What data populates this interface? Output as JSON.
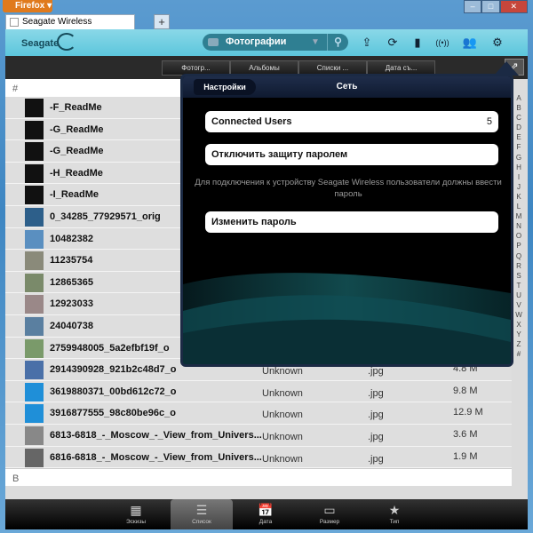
{
  "browser": {
    "menu": "Firefox",
    "tab_title": "Seagate Wireless",
    "new_tab": "+",
    "controls": [
      "–",
      "□",
      "✕"
    ]
  },
  "header": {
    "logo": "Seagate",
    "search_category": "Фотографии",
    "icons": [
      "upload-icon",
      "sync-icon",
      "battery-icon",
      "wifi-icon",
      "users-icon",
      "gear-icon"
    ]
  },
  "sort_tabs": [
    "Фотогр...",
    "Альбомы",
    "Списки ...",
    "Дата съ..."
  ],
  "list": {
    "section_hash": "#",
    "section_b": "B",
    "rows": [
      {
        "name": "-F_ReadMe",
        "thumb": "#111111"
      },
      {
        "name": "-G_ReadMe",
        "thumb": "#111111"
      },
      {
        "name": "-G_ReadMe",
        "thumb": "#111111"
      },
      {
        "name": "-H_ReadMe",
        "thumb": "#111111"
      },
      {
        "name": "-I_ReadMe",
        "thumb": "#111111"
      },
      {
        "name": "0_34285_77929571_orig",
        "thumb": "#2d5f8a"
      },
      {
        "name": "10482382",
        "thumb": "#5a8fc0"
      },
      {
        "name": "11235754",
        "thumb": "#8a8a7a"
      },
      {
        "name": "12865365",
        "thumb": "#7a8a6a"
      },
      {
        "name": "12923033",
        "thumb": "#9a8888"
      },
      {
        "name": "24040738",
        "thumb": "#5a7fa0"
      },
      {
        "name": "2759948005_5a2efbf19f_o",
        "thumb": "#7a9a6a"
      },
      {
        "name": "2914390928_921b2c48d7_o",
        "thumb": "#4a70a8",
        "author": "Unknown",
        "type": ".jpg",
        "size": "4.8 M"
      },
      {
        "name": "3619880371_00bd612c72_o",
        "thumb": "#1f8fd8",
        "author": "Unknown",
        "type": ".jpg",
        "size": "9.8 M"
      },
      {
        "name": "3916877555_98c80be96c_o",
        "thumb": "#1f8fd8",
        "author": "Unknown",
        "type": ".jpg",
        "size": "12.9 M"
      },
      {
        "name": "6813-6818_-_Moscow_-_View_from_Univers...",
        "thumb": "#888888",
        "author": "Unknown",
        "type": ".jpg",
        "size": "3.6 M"
      },
      {
        "name": "6816-6818_-_Moscow_-_View_from_Univers...",
        "thumb": "#666666",
        "author": "Unknown",
        "type": ".jpg",
        "size": "1.9 M"
      }
    ]
  },
  "alphabet": [
    "A",
    "B",
    "C",
    "D",
    "E",
    "F",
    "G",
    "H",
    "I",
    "J",
    "K",
    "L",
    "M",
    "N",
    "O",
    "P",
    "Q",
    "R",
    "S",
    "T",
    "U",
    "V",
    "W",
    "X",
    "Y",
    "Z",
    "#"
  ],
  "popup": {
    "back": "Настройки",
    "title": "Сеть",
    "connected_users_label": "Connected Users",
    "connected_users_value": "5",
    "disable_password": "Отключить защиту паролем",
    "note": "Для подключения к устройству Seagate Wireless пользователи должны ввести пароль",
    "change_password": "Изменить пароль"
  },
  "bottom_tabs": [
    {
      "label": "Эскизы",
      "icon": "▦"
    },
    {
      "label": "Список",
      "icon": "☰"
    },
    {
      "label": "Дата",
      "icon": "📅"
    },
    {
      "label": "Размер",
      "icon": "▭"
    },
    {
      "label": "Тип",
      "icon": "★"
    }
  ],
  "active_bottom_tab": "Список"
}
